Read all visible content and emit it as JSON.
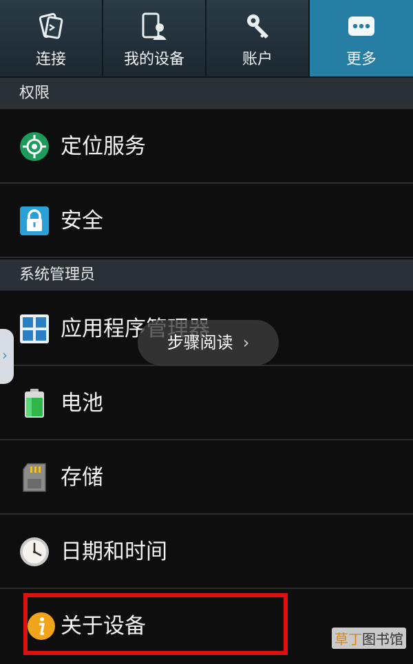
{
  "tabs": [
    {
      "label": "连接",
      "icon": "connections-icon",
      "active": false
    },
    {
      "label": "我的设备",
      "icon": "my-device-icon",
      "active": false
    },
    {
      "label": "账户",
      "icon": "accounts-icon",
      "active": false
    },
    {
      "label": "更多",
      "icon": "more-icon",
      "active": true
    }
  ],
  "sections": {
    "permissions": "权限",
    "system_manager": "系统管理员"
  },
  "rows": {
    "location": {
      "label": "定位服务",
      "icon": "location-icon"
    },
    "security": {
      "label": "安全",
      "icon": "lock-icon"
    },
    "app_manager": {
      "label": "应用程序管理器",
      "icon": "app-grid-icon"
    },
    "battery": {
      "label": "电池",
      "icon": "battery-icon"
    },
    "storage": {
      "label": "存储",
      "icon": "sd-card-icon"
    },
    "datetime": {
      "label": "日期和时间",
      "icon": "clock-icon"
    },
    "about": {
      "label": "关于设备",
      "icon": "info-icon"
    }
  },
  "overlay": {
    "label": "步骤阅读",
    "chevron": "›"
  },
  "handle": {
    "chevron": "›"
  },
  "watermark": {
    "part1": "草丁",
    "part2": "图书馆"
  },
  "colors": {
    "active_tab": "#277ea5",
    "highlight": "#e01010",
    "location_green": "#1e9b5a",
    "security_blue": "#2aa0d6"
  }
}
